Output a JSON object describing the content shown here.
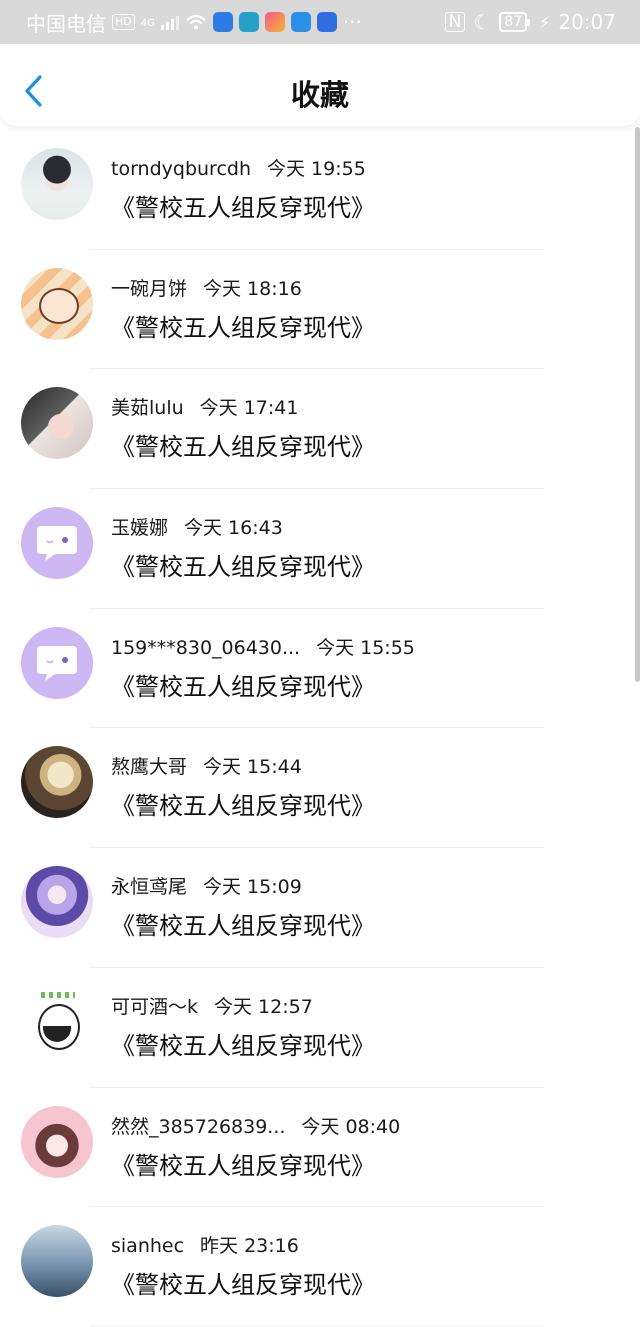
{
  "status_bar": {
    "carrier": "中国电信",
    "hd": "HD",
    "network": "4G",
    "battery": "87",
    "time": "20:07",
    "more": "···"
  },
  "header": {
    "title": "收藏",
    "accent_color": "#1a8fe3"
  },
  "items": [
    {
      "user": "torndyqburcdh",
      "time": "今天 19:55",
      "title": "《警校五人组反穿现代》",
      "avatar": "photo-girl-light"
    },
    {
      "user": "一碗月饼",
      "time": "今天 18:16",
      "title": "《警校五人组反穿现代》",
      "avatar": "cartoon-character"
    },
    {
      "user": "美茹lulu",
      "time": "今天 17:41",
      "title": "《警校五人组反穿现代》",
      "avatar": "photo-girl"
    },
    {
      "user": "玉媛娜",
      "time": "今天 16:43",
      "title": "《警校五人组反穿现代》",
      "avatar": "default-chat-bubble"
    },
    {
      "user": "159***830_06430...",
      "time": "今天 15:55",
      "title": "《警校五人组反穿现代》",
      "avatar": "default-chat-bubble"
    },
    {
      "user": "熬鹰大哥",
      "time": "今天 15:44",
      "title": "《警校五人组反穿现代》",
      "avatar": "illustration-warrior"
    },
    {
      "user": "永恒鸢尾",
      "time": "今天 15:09",
      "title": "《警校五人组反穿现代》",
      "avatar": "anime-girl-purple"
    },
    {
      "user": "可可酒～k",
      "time": "今天 12:57",
      "title": "《警校五人组反穿现代》",
      "avatar": "cartoon-face"
    },
    {
      "user": "然然_385726839...",
      "time": "今天 08:40",
      "title": "《警校五人组反穿现代》",
      "avatar": "anime-girl-pink"
    },
    {
      "user": "sianhec",
      "time": "昨天 23:16",
      "title": "《警校五人组反穿现代》",
      "avatar": "photo-landscape-blue"
    }
  ]
}
